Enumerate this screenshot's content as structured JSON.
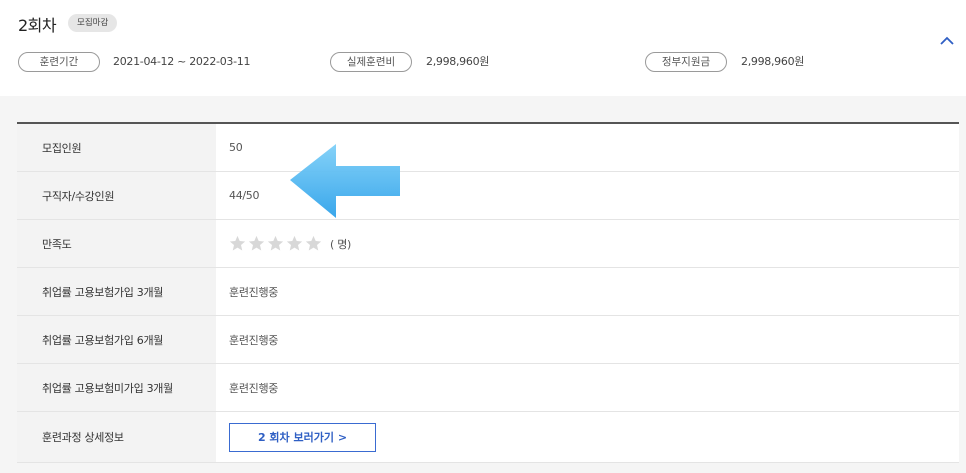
{
  "session": {
    "title": "2회차",
    "status_badge": "모집마감"
  },
  "meta": {
    "training_period_label": "훈련기간",
    "training_period_value": "2021-04-12 ~ 2022-03-11",
    "actual_fee_label": "실제훈련비",
    "actual_fee_value": "2,998,960원",
    "gov_support_label": "정부지원금",
    "gov_support_value": "2,998,960원"
  },
  "table": {
    "rows": [
      {
        "label": "모집인원",
        "value": "50"
      },
      {
        "label": "구직자/수강인원",
        "value": "44/50"
      },
      {
        "label": "만족도",
        "value": "( 명)"
      },
      {
        "label": "취업률 고용보험가입 3개월",
        "value": "훈련진행중"
      },
      {
        "label": "취업률 고용보험가입 6개월",
        "value": "훈련진행중"
      },
      {
        "label": "취업률 고용보험미가입 3개월",
        "value": "훈련진행중"
      },
      {
        "label": "훈련과정 상세정보",
        "button_label": "2 회차 보러가기 >"
      }
    ],
    "satisfaction_rating": {
      "value": 0,
      "max": 5
    }
  },
  "icons": {
    "collapse": "chevron-up-icon",
    "star": "star-icon",
    "annotation_arrow": "arrow-left-icon"
  },
  "colors": {
    "accent": "#2f5fc4",
    "arrow_fill": "#4fb6f2",
    "star_empty": "#d8d8d8"
  }
}
